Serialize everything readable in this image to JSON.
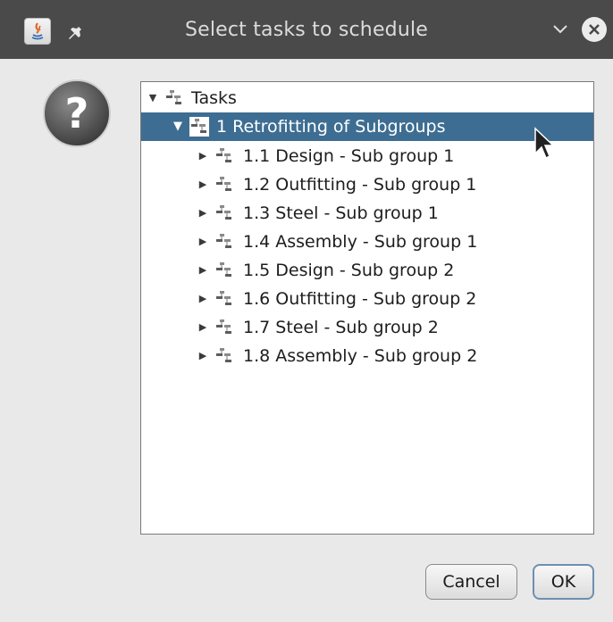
{
  "window": {
    "title": "Select tasks to schedule"
  },
  "tree": {
    "root": {
      "label": "Tasks",
      "expanded": true
    },
    "parent": {
      "label": "1 Retrofitting of Subgroups",
      "expanded": true,
      "selected": true
    },
    "children": [
      {
        "label": "1.1 Design - Sub group 1"
      },
      {
        "label": "1.2 Outfitting - Sub group 1"
      },
      {
        "label": "1.3 Steel - Sub group 1"
      },
      {
        "label": "1.4 Assembly - Sub group 1"
      },
      {
        "label": "1.5 Design - Sub group 2"
      },
      {
        "label": "1.6 Outfitting - Sub group 2"
      },
      {
        "label": "1.7 Steel - Sub group 2"
      },
      {
        "label": "1.8 Assembly - Sub group 2"
      }
    ]
  },
  "buttons": {
    "cancel": "Cancel",
    "ok": "OK"
  },
  "icons": {
    "app": "java-icon",
    "pin": "pin-icon",
    "minimize": "chevron-down-icon",
    "close": "close-icon",
    "dialog": "question-icon",
    "node": "task-tree-node-icon",
    "expanded": "triangle-down-icon",
    "collapsed": "triangle-right-icon"
  },
  "colors": {
    "titlebar": "#4a4a4a",
    "selection": "#3d6d92",
    "background": "#e9e9e9"
  }
}
